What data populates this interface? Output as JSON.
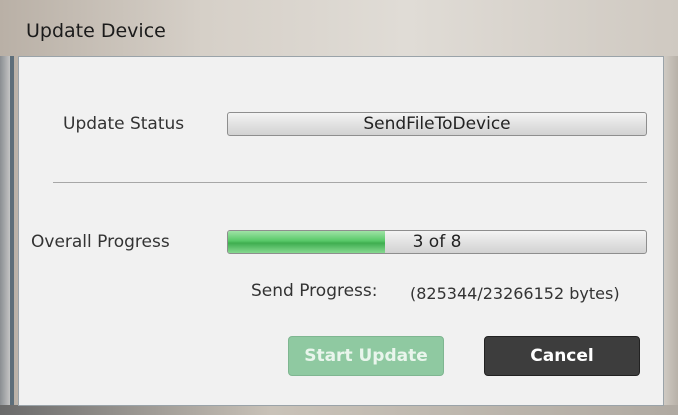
{
  "window": {
    "title": "Update Device"
  },
  "status": {
    "label": "Update Status",
    "value": "SendFileToDevice"
  },
  "progress": {
    "overall_label": "Overall Progress",
    "overall_text": "3 of 8",
    "overall_fraction": 0.375,
    "send_label": "Send Progress:",
    "send_value": "(825344/23266152 bytes)"
  },
  "buttons": {
    "start": "Start Update",
    "cancel": "Cancel"
  },
  "colors": {
    "progress_fill": "#57c867",
    "start_disabled": "#8fc9a1",
    "cancel_bg": "#3d3d3d"
  }
}
